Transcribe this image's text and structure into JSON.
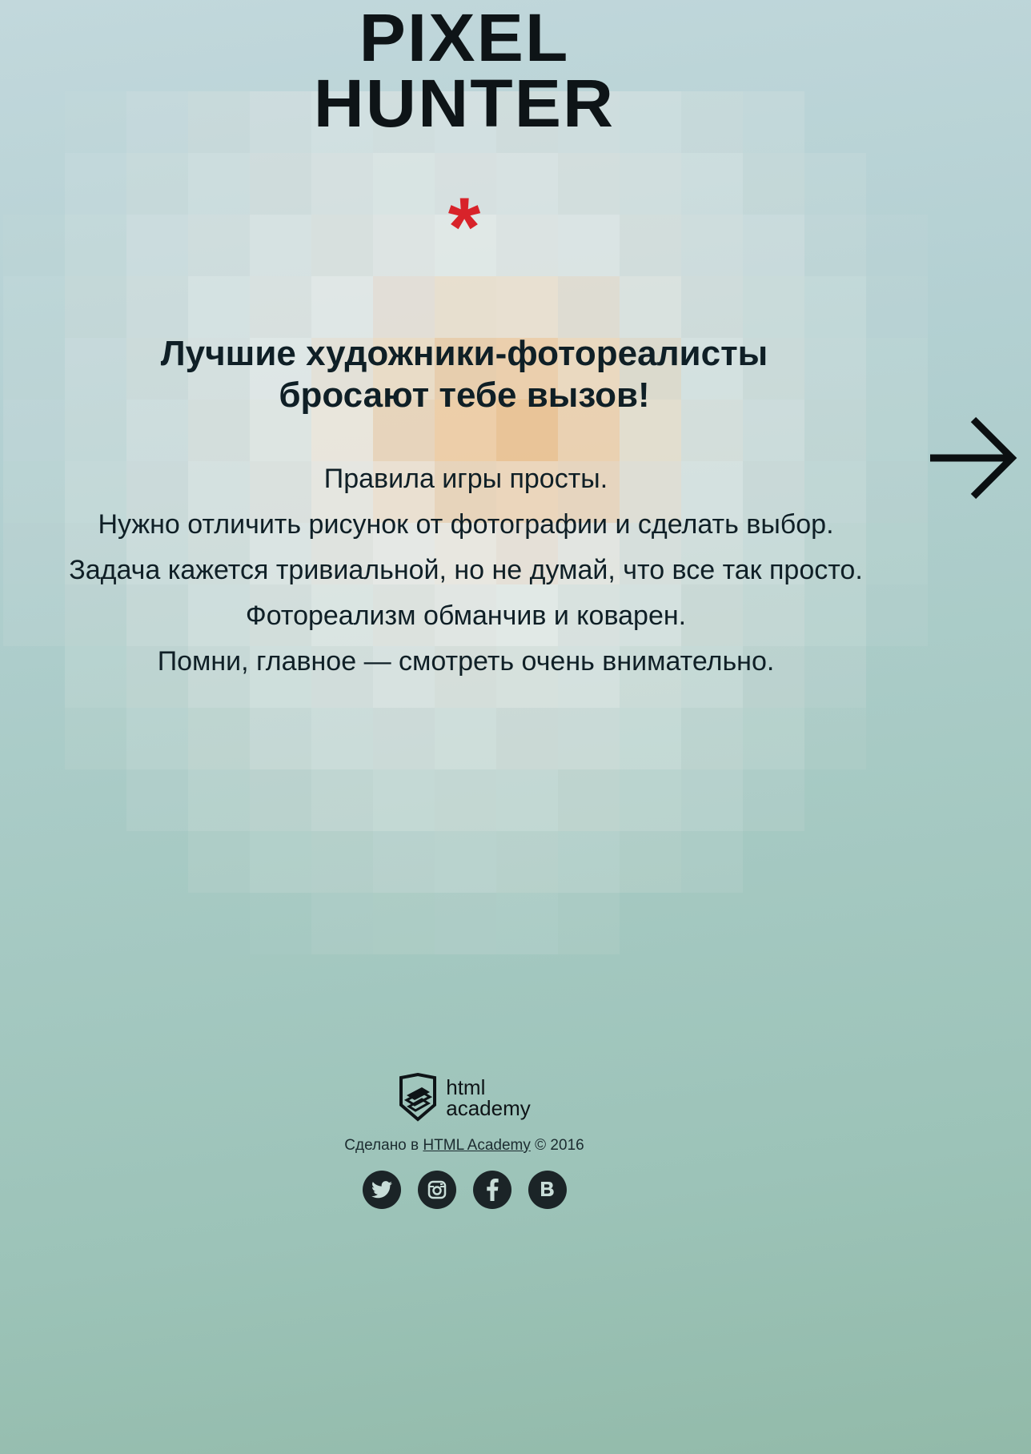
{
  "logo": {
    "line1": "PIXEL",
    "line2": "HUNTER"
  },
  "intro": {
    "asterisk": "*",
    "title_line1": "Лучшие художники-фотореалисты",
    "title_line2": "бросают тебе вызов!",
    "rules": [
      "Правила игры просты.",
      "Нужно отличить рисунок от фотографии и сделать выбор.",
      "Задача кажется тривиальной, но не думай, что все так просто.",
      "Фотореализм обманчив и коварен.",
      "Помни, главное — смотреть очень внимательно."
    ],
    "next_icon": "arrow-right-icon"
  },
  "footer": {
    "academy_logo_line1": "html",
    "academy_logo_line2": "academy",
    "made_in": "Сделано в",
    "academy_link": "HTML Academy",
    "copyright": "© 2016",
    "socials": [
      {
        "label": "Twitter",
        "icon": "twitter-icon"
      },
      {
        "label": "Instagram",
        "icon": "instagram-icon"
      },
      {
        "label": "Facebook",
        "icon": "facebook-icon"
      },
      {
        "label": "VK",
        "icon": "vk-icon"
      }
    ]
  },
  "colors": {
    "accent": "#d8232a",
    "text": "#0f1f26",
    "icon_bg": "#1b2427"
  }
}
